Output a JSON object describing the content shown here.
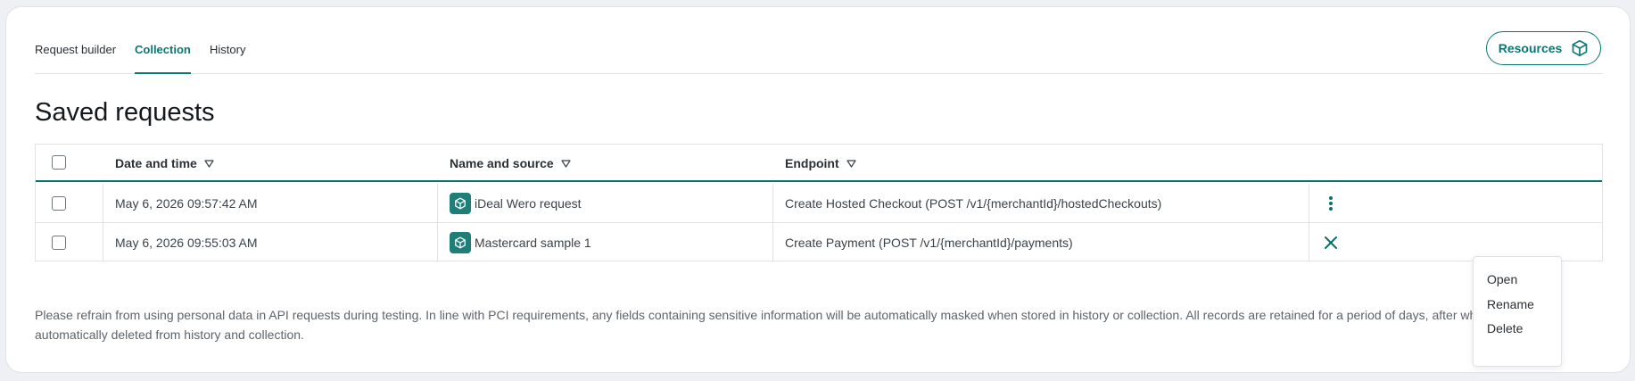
{
  "tabs": [
    {
      "label": "Request builder"
    },
    {
      "label": "Collection"
    },
    {
      "label": "History"
    }
  ],
  "header": {
    "resources_label": "Resources",
    "resources_icon": "cube-icon"
  },
  "page": {
    "title": "Saved requests"
  },
  "table": {
    "columns": [
      "Date and time",
      "Name and source",
      "Endpoint"
    ],
    "rows": [
      {
        "date": "May 6, 2026 09:57:42 AM",
        "name": "iDeal Wero request",
        "endpoint": "Create Hosted Checkout (POST /v1/{merchantId}/hostedCheckouts)",
        "action_icon": "more-vertical-icon"
      },
      {
        "date": "May 6, 2026 09:55:03 AM",
        "name": "Mastercard sample 1",
        "endpoint": "Create Payment (POST /v1/{merchantId}/payments)",
        "action_icon": "close-icon"
      }
    ]
  },
  "context_menu": {
    "items": [
      "Open",
      "Rename",
      "Delete"
    ]
  },
  "footer": {
    "note": "Please refrain from using personal data in API requests during testing. In line with PCI requirements, any fields containing sensitive information will be automatically masked when stored in history or collection. All records are retained for a period of days, after which they are automatically deleted from history and collection."
  },
  "colors": {
    "accent": "#0a7774",
    "icon_bg": "#1f7e78"
  }
}
